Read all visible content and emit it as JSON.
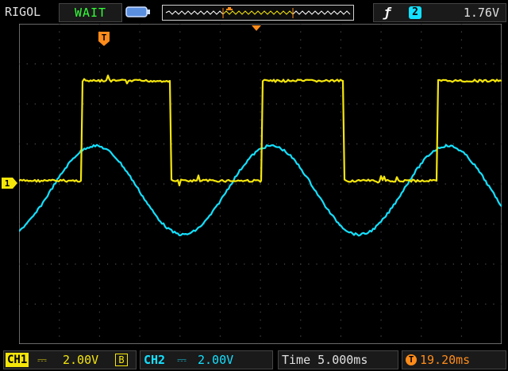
{
  "header": {
    "brand": "RIGOL",
    "status": "WAIT",
    "trigger": {
      "slope_symbol": "ƒ",
      "source": "2",
      "level": "1.76V"
    }
  },
  "markers": {
    "trigger_position": "T",
    "ch1_ground": "1"
  },
  "footer": {
    "ch1": {
      "tag": "CH1",
      "scale": "2.00V",
      "bw_limit": "B"
    },
    "ch2": {
      "tag": "CH2",
      "scale": "2.00V"
    },
    "timebase": "Time 5.000ms",
    "trigger_offset": "19.20ms"
  },
  "colors": {
    "ch1": "#f5e60a",
    "ch2": "#14e0ff",
    "trigger": "#ff8c1a",
    "grid": "#505050",
    "status": "#35ff3a"
  }
}
